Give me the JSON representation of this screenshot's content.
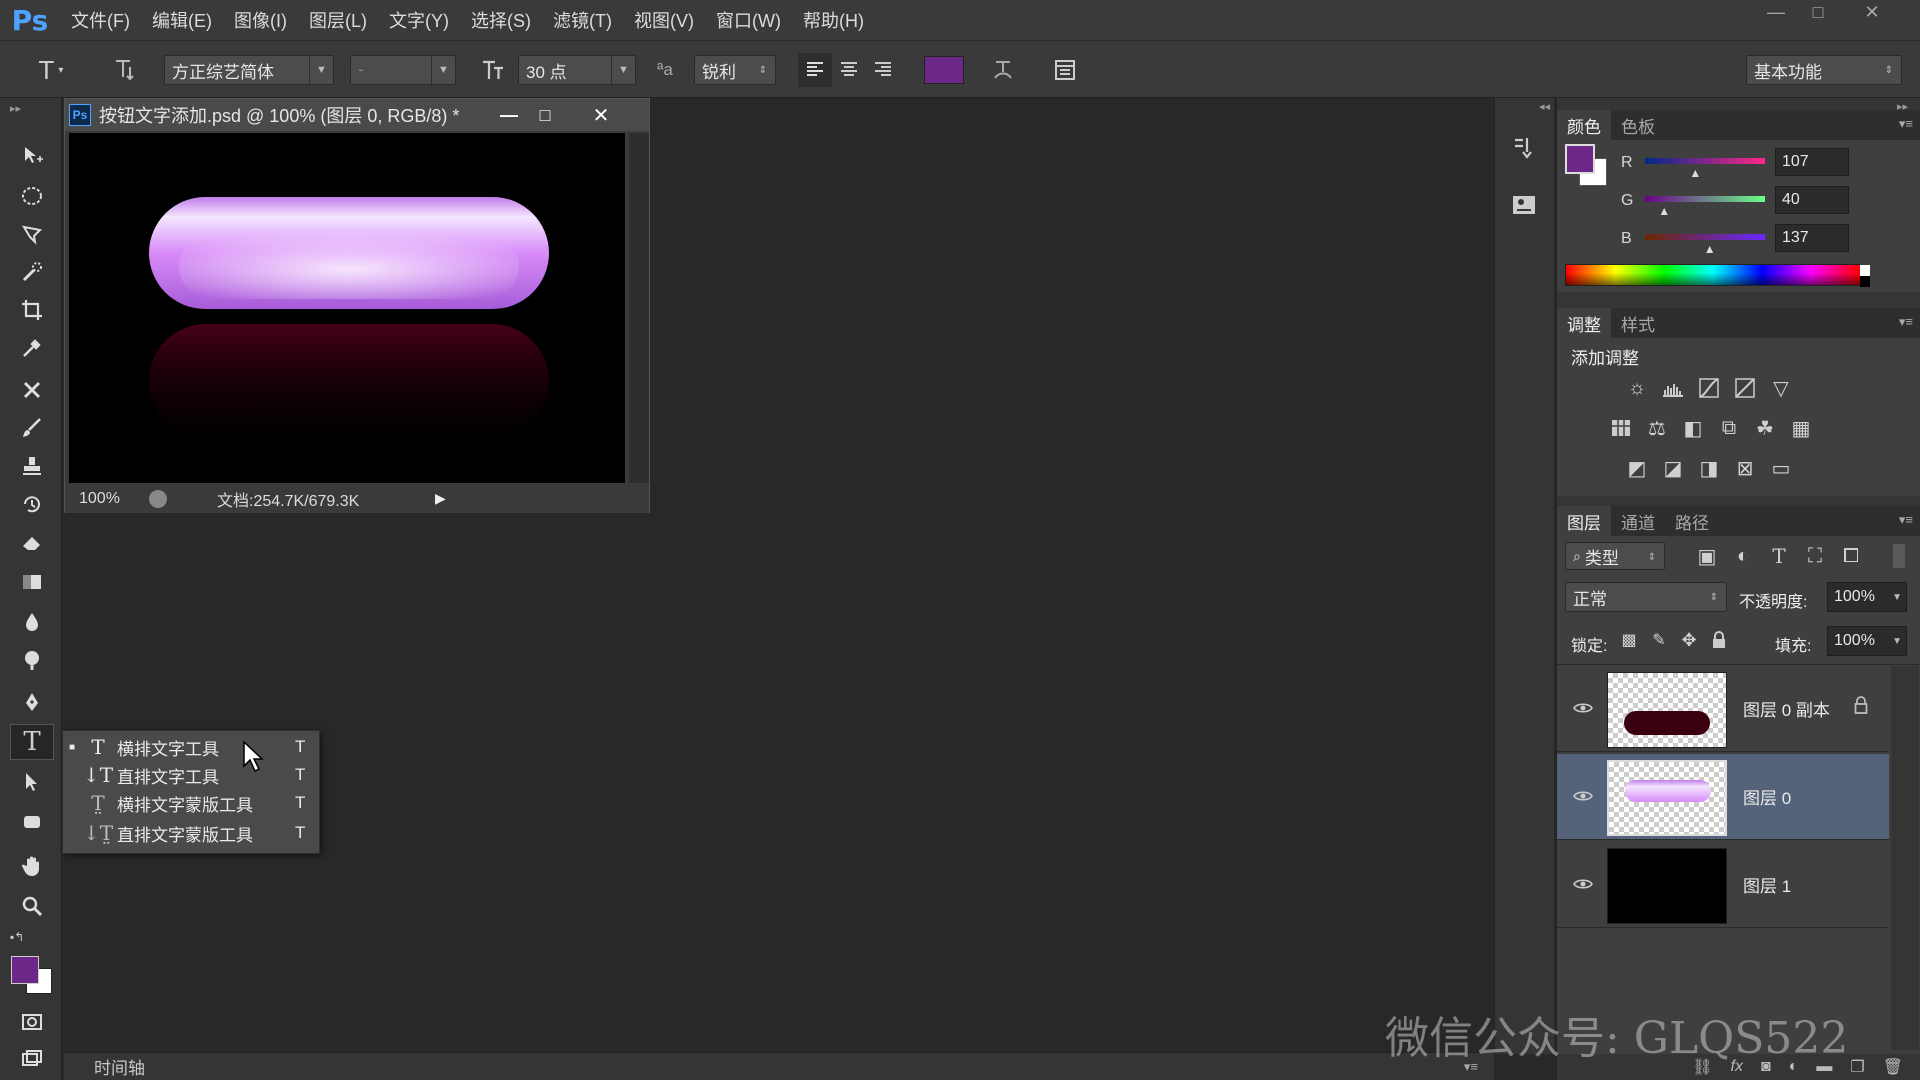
{
  "app": {
    "logo": "Ps"
  },
  "menu": [
    "文件(F)",
    "编辑(E)",
    "图像(I)",
    "图层(L)",
    "文字(Y)",
    "选择(S)",
    "滤镜(T)",
    "视图(V)",
    "窗口(W)",
    "帮助(H)"
  ],
  "options": {
    "font_family": "方正综艺简体",
    "font_style": "-",
    "font_size": "30 点",
    "antialias": "锐利",
    "text_color": "#6b2889",
    "workspace": "基本功能"
  },
  "document": {
    "title": "按钮文字添加.psd @ 100% (图层 0, RGB/8) *",
    "zoom": "100%",
    "doc_size": "文档:254.7K/679.3K"
  },
  "flyout": {
    "items": [
      {
        "label": "横排文字工具",
        "shortcut": "T",
        "selected": true
      },
      {
        "label": "直排文字工具",
        "shortcut": "T",
        "selected": false
      },
      {
        "label": "横排文字蒙版工具",
        "shortcut": "T",
        "selected": false
      },
      {
        "label": "直排文字蒙版工具",
        "shortcut": "T",
        "selected": false
      }
    ]
  },
  "color_panel": {
    "tabs": [
      "颜色",
      "色板"
    ],
    "r_label": "R",
    "g_label": "G",
    "b_label": "B",
    "r": "107",
    "g": "40",
    "b": "137",
    "r_frac": 0.42,
    "g_frac": 0.16,
    "b_frac": 0.54,
    "foreground": "#6b2889",
    "background": "#ffffff"
  },
  "adjust_panel": {
    "tabs": [
      "调整",
      "样式"
    ],
    "heading": "添加调整"
  },
  "layers_panel": {
    "tabs": [
      "图层",
      "通道",
      "路径"
    ],
    "filter_label": "类型",
    "blend_mode": "正常",
    "opacity_label": "不透明度:",
    "opacity": "100%",
    "lock_label": "锁定:",
    "fill_label": "填充:",
    "fill": "100%",
    "layers": [
      {
        "name": "图层 0 副本",
        "selected": false,
        "locked": true
      },
      {
        "name": "图层 0",
        "selected": true,
        "locked": false
      },
      {
        "name": "图层 1",
        "selected": false,
        "locked": false
      }
    ]
  },
  "timeline": {
    "label": "时间轴"
  },
  "watermark": "微信公众号: GLQS522",
  "icons": {
    "close": "✕",
    "minimize": "—",
    "maximize": "□"
  }
}
